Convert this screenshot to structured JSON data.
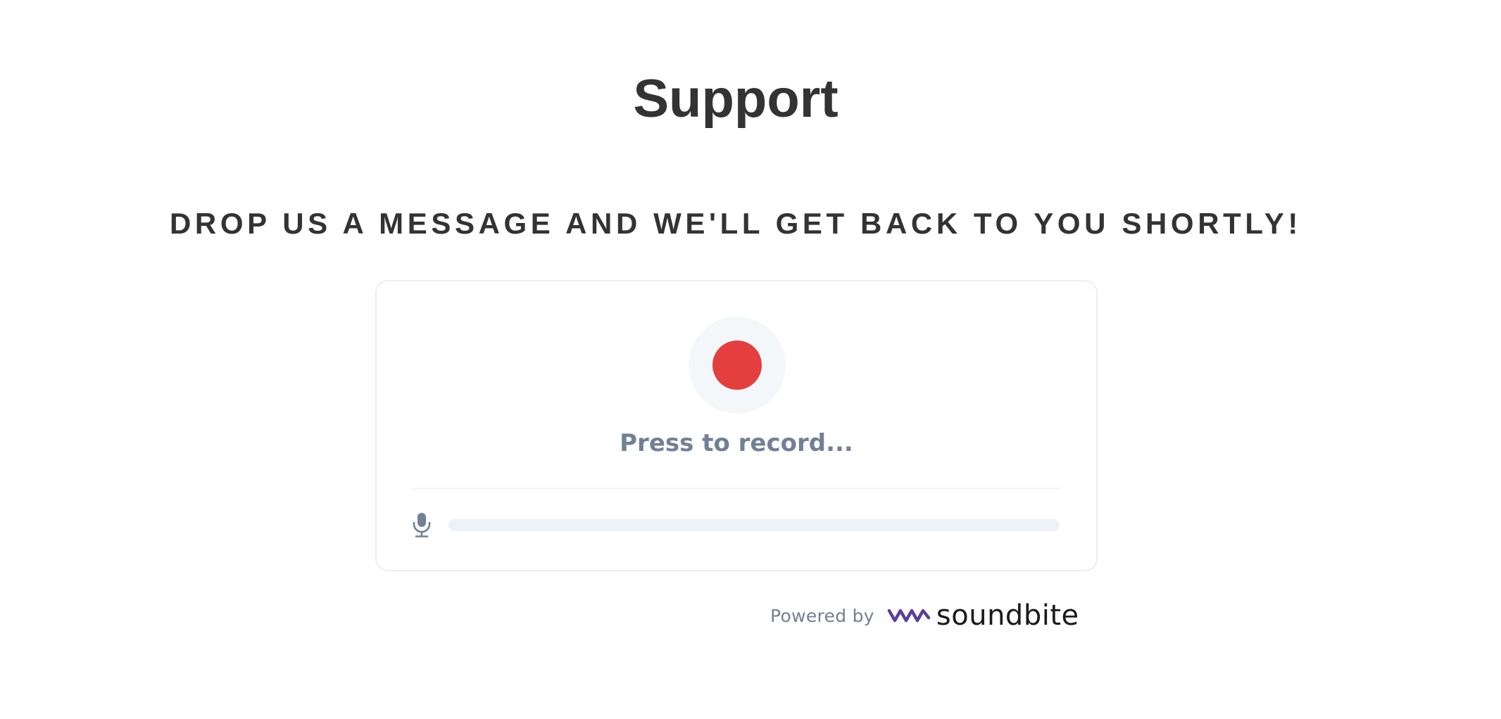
{
  "header": {
    "title": "Support",
    "subtitle": "DROP US A MESSAGE AND WE'LL GET BACK TO YOU SHORTLY!"
  },
  "recorder": {
    "status_label": "Press to record...",
    "record_icon": "record-dot-icon",
    "mic_icon": "microphone-icon",
    "progress": 0,
    "colors": {
      "record": "#e53e3e",
      "ring": "#f4f7fa",
      "track": "#edf2f7",
      "label": "#718096"
    }
  },
  "footer": {
    "powered_by_label": "Powered by",
    "brand_name": "soundbite",
    "brand_icon": "soundbite-wave-logo",
    "brand_color": "#5b3f99"
  }
}
